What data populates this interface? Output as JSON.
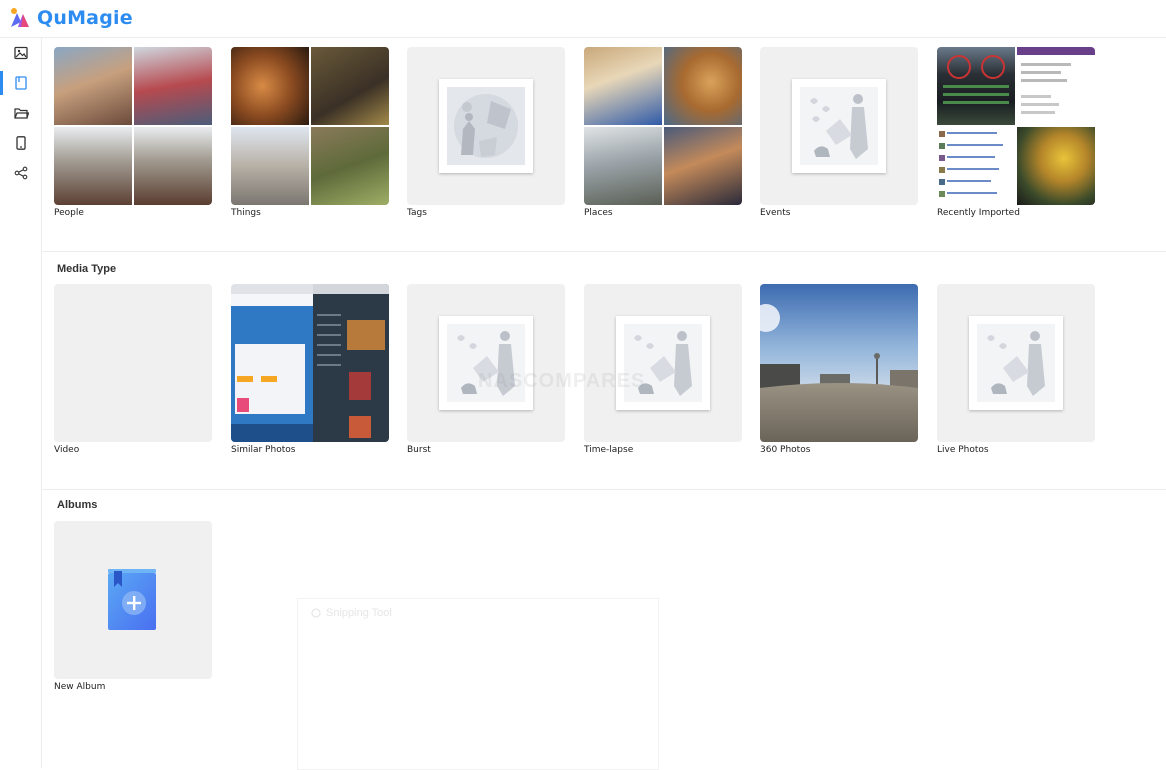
{
  "app": {
    "name": "QuMagie"
  },
  "sidebar": {
    "items": [
      {
        "name": "photos-icon"
      },
      {
        "name": "smart-album-icon"
      },
      {
        "name": "folder-icon"
      },
      {
        "name": "mobile-icon"
      },
      {
        "name": "share-icon"
      }
    ]
  },
  "collections": {
    "items": [
      {
        "label": "People"
      },
      {
        "label": "Things"
      },
      {
        "label": "Tags"
      },
      {
        "label": "Places"
      },
      {
        "label": "Events"
      },
      {
        "label": "Recently Imported"
      }
    ]
  },
  "media_type": {
    "title": "Media Type",
    "items": [
      {
        "label": "Video"
      },
      {
        "label": "Similar Photos"
      },
      {
        "label": "Burst"
      },
      {
        "label": "Time-lapse"
      },
      {
        "label": "360 Photos"
      },
      {
        "label": "Live Photos"
      }
    ]
  },
  "albums": {
    "title": "Albums",
    "items": [
      {
        "label": "New Album"
      }
    ]
  },
  "overlay": {
    "watermark": "NASCOMPARES",
    "snipping_title": "Snipping Tool"
  },
  "colors": {
    "accent": "#2d8cf0",
    "tile_bg": "#f0f0f0"
  }
}
